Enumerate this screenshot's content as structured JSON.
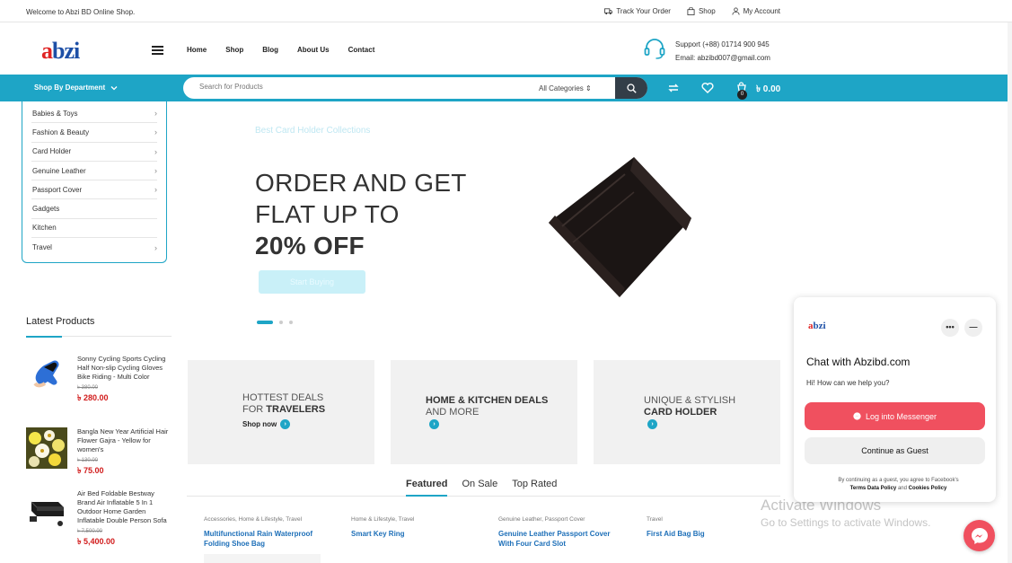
{
  "topbar": {
    "welcome": "Welcome to Abzi BD Online Shop.",
    "links": [
      {
        "label": "Track Your Order",
        "icon": "truck-icon"
      },
      {
        "label": "Shop",
        "icon": "bag-icon"
      },
      {
        "label": "My Account",
        "icon": "user-icon"
      }
    ]
  },
  "header": {
    "logo_first": "a",
    "logo_rest": "bzi",
    "nav": [
      "Home",
      "Shop",
      "Blog",
      "About Us",
      "Contact"
    ],
    "support_line": "Support (+88) 01714 900 945",
    "email_line": "Email: abzibd007@gmail.com"
  },
  "bluebar": {
    "department": "Shop By Department",
    "search_placeholder": "Search for Products",
    "category_select": "All Categories",
    "cart_amount": "৳ 0.00",
    "cart_count": "0"
  },
  "categories": [
    "Babies & Toys",
    "Fashion & Beauty",
    "Card Holder",
    "Genuine Leather",
    "Passport Cover",
    "Gadgets",
    "Kitchen",
    "Travel"
  ],
  "category_has_arrow": [
    true,
    true,
    true,
    true,
    true,
    false,
    false,
    true
  ],
  "latest": {
    "title": "Latest Products",
    "items": [
      {
        "name": "Sonny Cycling Sports Cycling Half Non-slip Cycling Gloves Bike Riding - Multi Color",
        "old": "৳ 380.00",
        "price": "৳ 280.00"
      },
      {
        "name": "Bangla New Year Artificial Hair Flower Gajra - Yellow for women's",
        "old": "৳ 130.00",
        "price": "৳ 75.00"
      },
      {
        "name": "Air Bed Foldable Bestway Brand Air Inflatable 5 In 1 Outdoor Home Garden Inflatable Double Person Sofa",
        "old": "৳ 7,500.00",
        "price": "৳ 5,400.00"
      }
    ]
  },
  "hero": {
    "subtitle": "Best Card Holder Collections",
    "line1": "ORDER AND GET",
    "line2": "FLAT UP TO",
    "line3": "20% OFF",
    "button": "Start Buying"
  },
  "promos": [
    {
      "light": "HOTTEST DEALS",
      "prefix": "FOR ",
      "bold": "TRAVELERS",
      "link": "Shop now"
    },
    {
      "bold": "HOME & KITCHEN DEALS",
      "light": "AND MORE",
      "link": ""
    },
    {
      "light": "UNIQUE & STYLISH",
      "bold": "CARD HOLDER",
      "link": ""
    }
  ],
  "tabs": [
    "Featured",
    "On Sale",
    "Top Rated"
  ],
  "products": [
    {
      "cat": "Accessories, Home & Lifestyle, Travel",
      "name": "Multifunctional Rain Waterproof Folding Shoe Bag"
    },
    {
      "cat": "Home & Lifestyle, Travel",
      "name": "Smart Key Ring"
    },
    {
      "cat": "Genuine Leather, Passport Cover",
      "name": "Genuine Leather Passport Cover With Four Card Slot"
    },
    {
      "cat": "Travel",
      "name": "First Aid Bag Big"
    }
  ],
  "chat": {
    "logo": "abzi",
    "title": "Chat with Abzibd.com",
    "greeting": "Hi! How can we help you?",
    "login": "Log into Messenger",
    "guest": "Continue as Guest",
    "legal_pre": "By continuing as a guest, you agree to Facebook's",
    "terms": "Terms",
    "data_policy": "Data Policy",
    "and": "and",
    "cookies": "Cookies Policy"
  },
  "watermark": {
    "line1": "Activate Windows",
    "line2": "Go to Settings to activate Windows."
  },
  "colors": {
    "accent": "#1ea5c6",
    "dark": "#333e48",
    "price": "#d11b1b",
    "messenger": "#f0505f"
  }
}
